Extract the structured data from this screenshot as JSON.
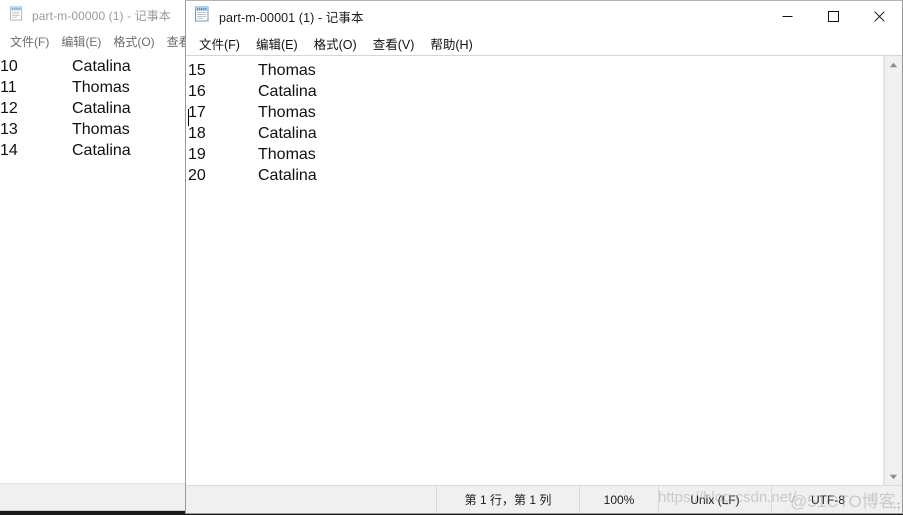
{
  "app": {
    "name": "Notepad",
    "icon": "notepad-icon"
  },
  "background_window": {
    "title": "part-m-00000 (1) - 记事本",
    "menu": [
      {
        "label": "文件(F)"
      },
      {
        "label": "编辑(E)"
      },
      {
        "label": "格式(O)"
      },
      {
        "label": "查看"
      }
    ],
    "lines": [
      {
        "no": "10",
        "name": "Catalina"
      },
      {
        "no": "11",
        "name": "Thomas"
      },
      {
        "no": "12",
        "name": "Catalina"
      },
      {
        "no": "13",
        "name": "Thomas"
      },
      {
        "no": "14",
        "name": "Catalina"
      }
    ]
  },
  "foreground_window": {
    "title": "part-m-00001 (1) - 记事本",
    "controls": {
      "minimize": "—",
      "maximize": "▢",
      "close": "✕"
    },
    "menu": [
      {
        "label": "文件(F)"
      },
      {
        "label": "编辑(E)"
      },
      {
        "label": "格式(O)"
      },
      {
        "label": "查看(V)"
      },
      {
        "label": "帮助(H)"
      }
    ],
    "lines": [
      {
        "no": "15",
        "name": "Thomas"
      },
      {
        "no": "16",
        "name": "Catalina"
      },
      {
        "no": "17",
        "name": "Thomas"
      },
      {
        "no": "18",
        "name": "Catalina"
      },
      {
        "no": "19",
        "name": "Thomas"
      },
      {
        "no": "20",
        "name": "Catalina"
      }
    ],
    "scrollbar": {
      "up_arrow": "▲",
      "down_arrow": "▼"
    },
    "statusbar": {
      "position": "第 1 行，第 1 列",
      "zoom": "100%",
      "line_ending": "Unix (LF)",
      "encoding": "UTF-8"
    }
  },
  "watermark": {
    "url": "https://blog.csdn.net/",
    "site": "@51CTO博客"
  },
  "colors": {
    "window_bg": "#ffffff",
    "statusbar_bg": "#f0f0f0",
    "desktop": "#1b1b1b",
    "inactive_title": "#9b9b9b",
    "active_title": "#1c1c1c",
    "close_hover": "#e81123"
  }
}
